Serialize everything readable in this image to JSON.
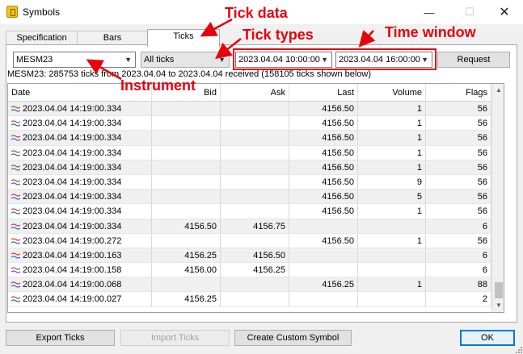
{
  "window": {
    "title": "Symbols",
    "minimize": "—",
    "maximize": "☐",
    "close": "✕"
  },
  "tabs": [
    {
      "label": "Specification"
    },
    {
      "label": "Bars"
    },
    {
      "label": "Ticks"
    }
  ],
  "controls": {
    "symbol": "MESM23",
    "tick_type": "All ticks",
    "from_time": "2023.04.04 10:00:00",
    "to_time": "2023.04.04 16:00:00",
    "request_label": "Request"
  },
  "info_text": "MESM23: 285753 ticks from 2023.04.04 to 2023.04.04 received (158105 ticks shown below)",
  "table": {
    "columns": [
      "Date",
      "Bid",
      "Ask",
      "Last",
      "Volume",
      "Flags"
    ],
    "rows": [
      [
        "2023.04.04 14:19:00.334",
        "",
        "",
        "4156.50",
        "1",
        "56"
      ],
      [
        "2023.04.04 14:19:00.334",
        "",
        "",
        "4156.50",
        "1",
        "56"
      ],
      [
        "2023.04.04 14:19:00.334",
        "",
        "",
        "4156.50",
        "1",
        "56"
      ],
      [
        "2023.04.04 14:19:00.334",
        "",
        "",
        "4156.50",
        "1",
        "56"
      ],
      [
        "2023.04.04 14:19:00.334",
        "",
        "",
        "4156.50",
        "1",
        "56"
      ],
      [
        "2023.04.04 14:19:00.334",
        "",
        "",
        "4156.50",
        "9",
        "56"
      ],
      [
        "2023.04.04 14:19:00.334",
        "",
        "",
        "4156.50",
        "5",
        "56"
      ],
      [
        "2023.04.04 14:19:00.334",
        "",
        "",
        "4156.50",
        "1",
        "56"
      ],
      [
        "2023.04.04 14:19:00.334",
        "4156.50",
        "4156.75",
        "",
        "",
        "6"
      ],
      [
        "2023.04.04 14:19:00.272",
        "",
        "",
        "4156.50",
        "1",
        "56"
      ],
      [
        "2023.04.04 14:19:00.163",
        "4156.25",
        "4156.50",
        "",
        "",
        "6"
      ],
      [
        "2023.04.04 14:19:00.158",
        "4156.00",
        "4156.25",
        "",
        "",
        "6"
      ],
      [
        "2023.04.04 14:19:00.068",
        "",
        "",
        "4156.25",
        "1",
        "88"
      ],
      [
        "2023.04.04 14:19:00.027",
        "4156.25",
        "",
        "",
        "",
        "2"
      ]
    ]
  },
  "buttons": {
    "export": "Export Ticks",
    "import": "Import Ticks",
    "create": "Create Custom Symbol",
    "ok": "OK"
  },
  "annotations": {
    "tick_data": "Tick data",
    "tick_types": "Tick types",
    "time_window": "Time window",
    "instrument": "Instrument"
  },
  "icons": {
    "app": "symbols-app-icon",
    "tick_row": "tick-wave-icon",
    "chevron": "chevron-down-icon"
  },
  "colors": {
    "annotation": "#e8000d",
    "accent": "#0078d7",
    "row_alt": "#f0f0f0"
  }
}
